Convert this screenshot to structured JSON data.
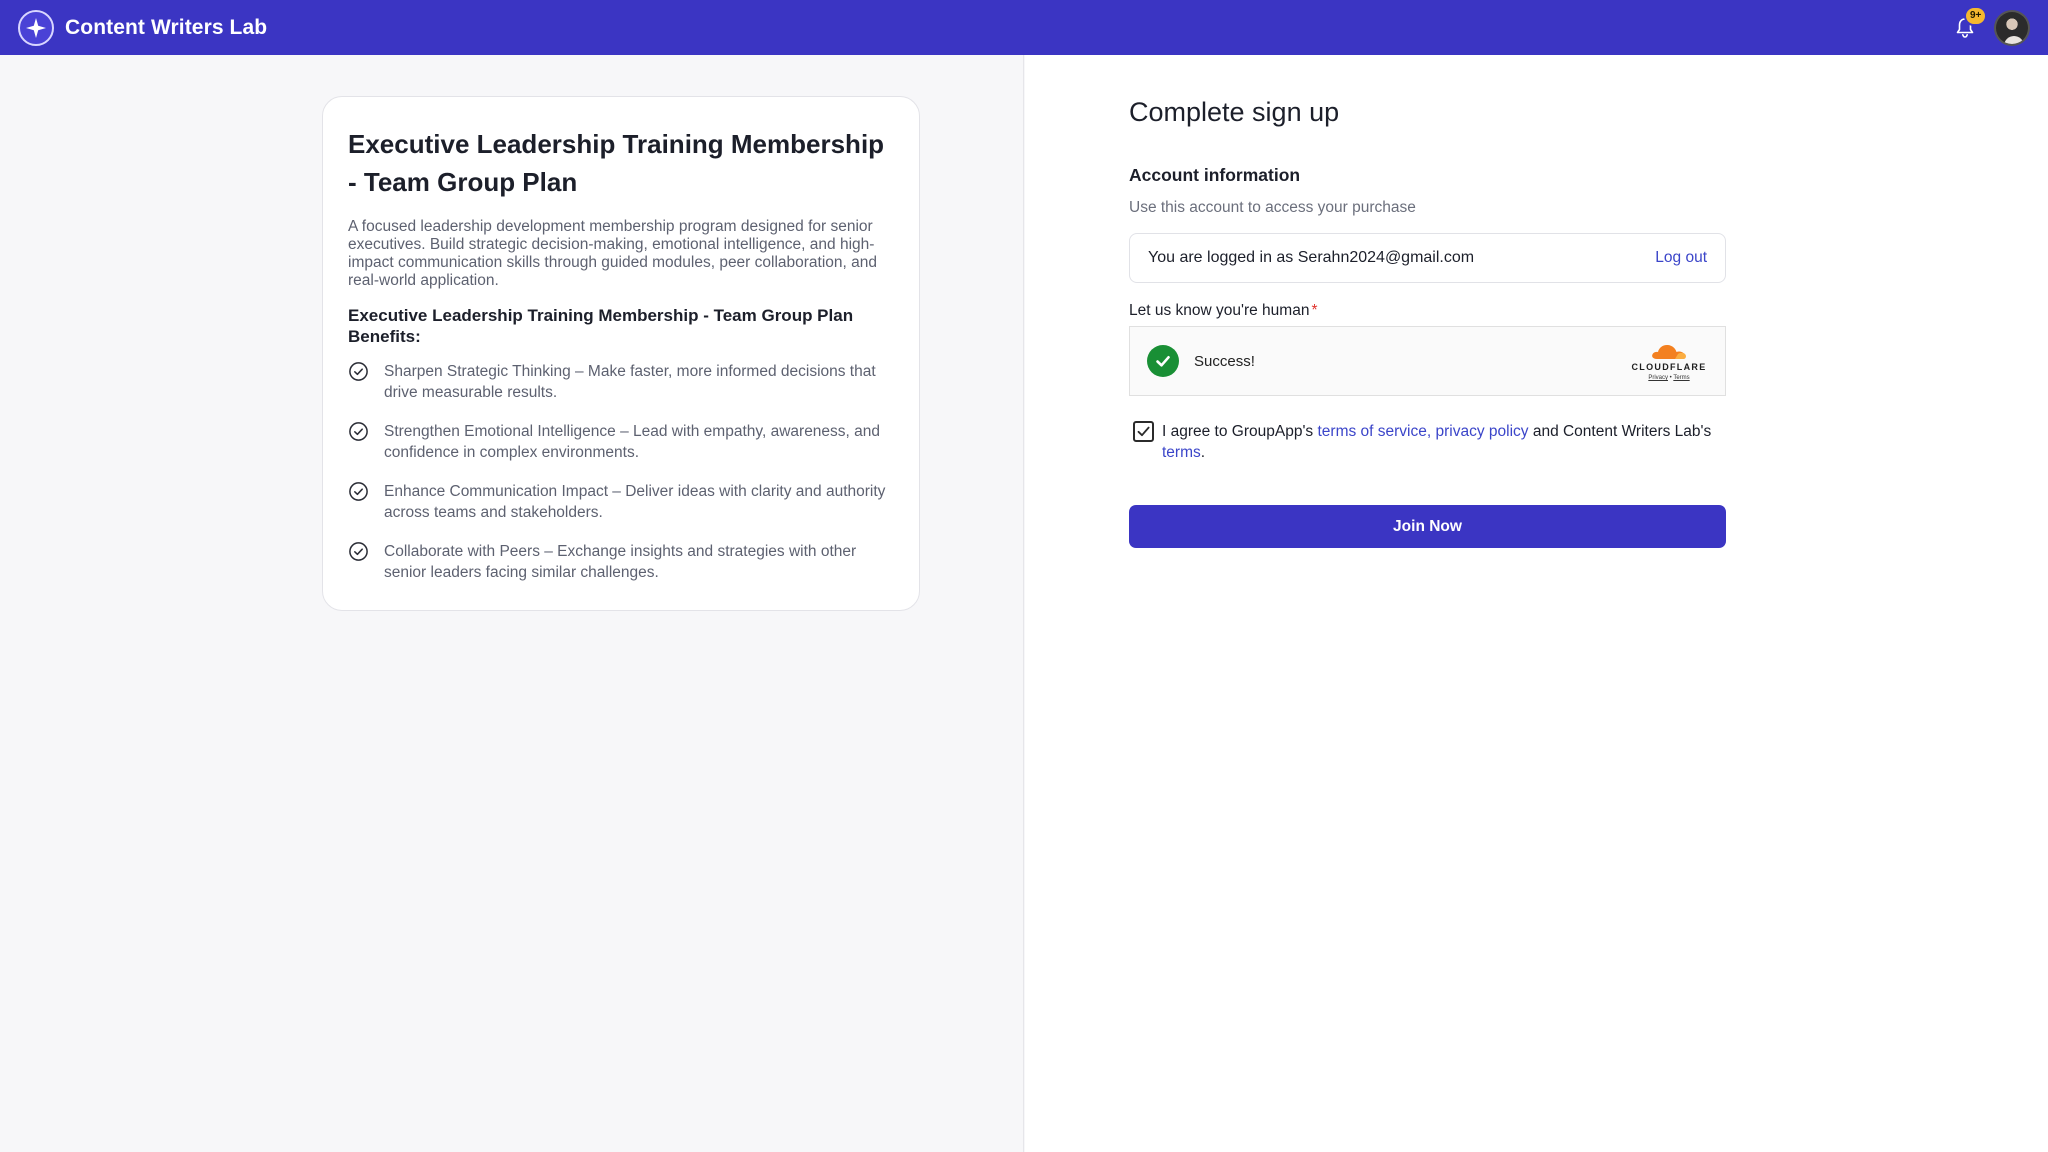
{
  "header": {
    "brand_name": "Content Writers Lab",
    "notification_badge": "9+"
  },
  "plan": {
    "title": "Executive Leadership Training Membership - Team Group Plan",
    "description": "A focused leadership development membership program designed for senior executives. Build strategic decision-making, emotional intelligence, and high-impact communication skills through guided modules, peer collaboration, and real-world application.",
    "benefits_title": "Executive Leadership Training Membership - Team Group Plan Benefits:",
    "benefits": [
      "Sharpen Strategic Thinking – Make faster, more informed decisions that drive measurable results.",
      "Strengthen Emotional Intelligence – Lead with empathy, awareness, and confidence in complex environments.",
      "Enhance Communication Impact – Deliver ideas with clarity and authority across teams and stakeholders.",
      "Collaborate with Peers – Exchange insights and strategies with other senior leaders facing similar challenges."
    ]
  },
  "signup": {
    "title": "Complete sign up",
    "account_title": "Account information",
    "account_sub": "Use this account to access your purchase",
    "logged_in_text": "You are logged in as Serahn2024@gmail.com",
    "logout_label": "Log out",
    "human_label": "Let us know you're human",
    "required_mark": "*",
    "captcha_status": "Success!",
    "captcha_brand": "CLOUDFLARE",
    "captcha_privacy": "Privacy",
    "captcha_separator": "•",
    "captcha_terms": "Terms",
    "agree_prefix": "I agree to GroupApp's ",
    "agree_link1": "terms of service, privacy policy",
    "agree_middle": " and Content Writers Lab's ",
    "agree_link2": "terms",
    "agree_suffix": ".",
    "agreed": true,
    "join_label": "Join Now"
  },
  "colors": {
    "brand": "#3b35c3",
    "link": "#3b45c9",
    "success": "#198f35",
    "cloudflare_orange": "#f38020",
    "required": "#e0322d",
    "badge": "#f5b82e"
  }
}
